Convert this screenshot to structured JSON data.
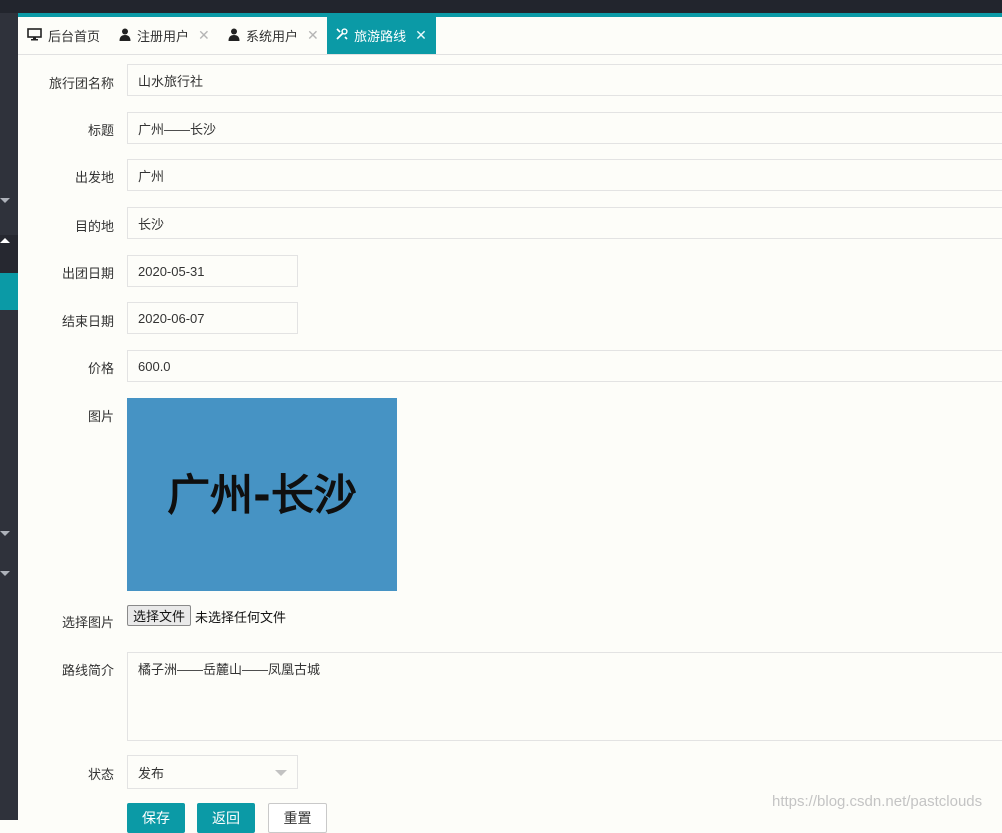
{
  "tabs": [
    {
      "label": "后台首页",
      "icon": "monitor-icon",
      "closable": false
    },
    {
      "label": "注册用户",
      "icon": "user-icon",
      "closable": true
    },
    {
      "label": "系统用户",
      "icon": "user-icon",
      "closable": true
    },
    {
      "label": "旅游路线",
      "icon": "tools-icon",
      "closable": true,
      "active": true
    }
  ],
  "close_glyph": "✕",
  "form": {
    "agency_label": "旅行团名称",
    "agency_value": "山水旅行社",
    "title_label": "标题",
    "title_value": "广州——长沙",
    "origin_label": "出发地",
    "origin_value": "广州",
    "destination_label": "目的地",
    "destination_value": "长沙",
    "start_date_label": "出团日期",
    "start_date_value": "2020-05-31",
    "end_date_label": "结束日期",
    "end_date_value": "2020-06-07",
    "price_label": "价格",
    "price_value": "600.0",
    "image_label": "图片",
    "image_text": "广州-长沙",
    "choose_image_label": "选择图片",
    "file_button_label": "选择文件",
    "file_status": "未选择任何文件",
    "intro_label": "路线简介",
    "intro_value": "橘子洲——岳麓山——凤凰古城",
    "status_label": "状态",
    "status_value": "发布"
  },
  "actions": {
    "save_label": "保存",
    "back_label": "返回",
    "reset_label": "重置"
  },
  "watermark": "https://blog.csdn.net/pastclouds",
  "colors": {
    "accent": "#0b9aa6",
    "image_bg": "#4693c4",
    "sidebar": "#2f323b",
    "topbar": "#22252d"
  }
}
